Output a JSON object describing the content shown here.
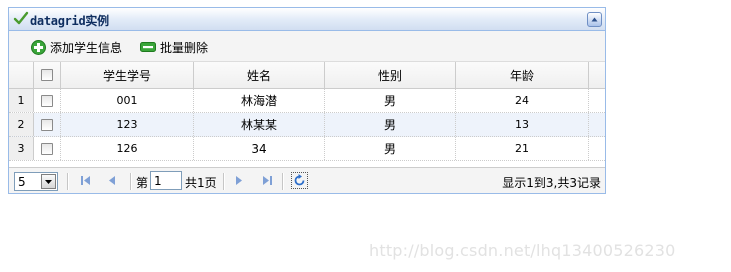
{
  "panel": {
    "title": "datagrid实例",
    "icons": {
      "title_icon": "check-icon",
      "collapse_icon": "collapse-up-icon"
    }
  },
  "toolbar": {
    "add_label": "添加学生信息",
    "delete_label": "批量删除",
    "icons": {
      "add": "green-plus-icon",
      "delete": "green-minus-icon"
    }
  },
  "grid": {
    "columns": [
      "学生学号",
      "姓名",
      "性别",
      "年龄"
    ],
    "rows": [
      {
        "num": "1",
        "id": "001",
        "name": "林海潜",
        "gender": "男",
        "age": "24"
      },
      {
        "num": "2",
        "id": "123",
        "name": "林某某",
        "gender": "男",
        "age": "13"
      },
      {
        "num": "3",
        "id": "126",
        "name": "34",
        "gender": "男",
        "age": "21"
      }
    ]
  },
  "pager": {
    "page_size": "5",
    "page_prefix": "第",
    "page_value": "1",
    "page_suffix": "共1页",
    "info": "显示1到3,共3记录"
  },
  "watermark": "http://blog.csdn.net/lhq13400526230",
  "colors": {
    "border": "#99bbe8",
    "header_text": "#0e2d5f",
    "row_alt": "#eef3fb",
    "icon_green": "#2e9a2e"
  }
}
